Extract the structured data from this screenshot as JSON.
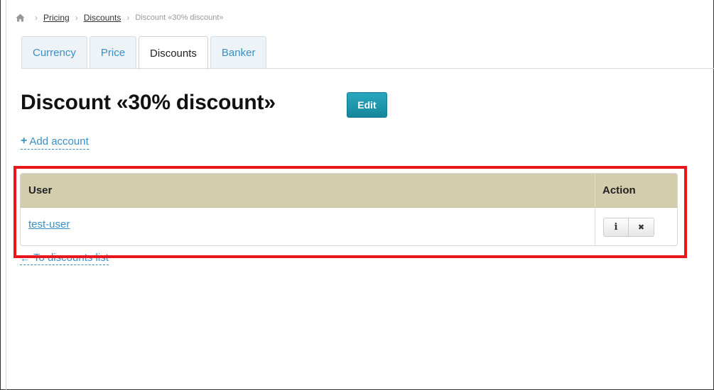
{
  "breadcrumb": {
    "home_icon": "home-icon",
    "items": [
      "Pricing",
      "Discounts"
    ],
    "current": "Discount «30% discount»",
    "separator": "›"
  },
  "tabs": [
    {
      "label": "Currency",
      "active": false
    },
    {
      "label": "Price",
      "active": false
    },
    {
      "label": "Discounts",
      "active": true
    },
    {
      "label": "Banker",
      "active": false
    }
  ],
  "page": {
    "title": "Discount «30% discount»",
    "edit_label": "Edit",
    "add_account": "Add account",
    "back_link": "To discounts list"
  },
  "table": {
    "columns": [
      "User",
      "Action"
    ],
    "rows": [
      {
        "user": "test-user",
        "actions": [
          "info-icon",
          "close-icon"
        ]
      }
    ]
  },
  "colors": {
    "accent": "#3a8ec6",
    "edit_button": "#1a94aa",
    "table_header": "#d3ccad",
    "highlight": "#e8171d"
  },
  "icons": {
    "info": "i",
    "close": "✖",
    "plus": "+",
    "back_arrow": "←"
  }
}
